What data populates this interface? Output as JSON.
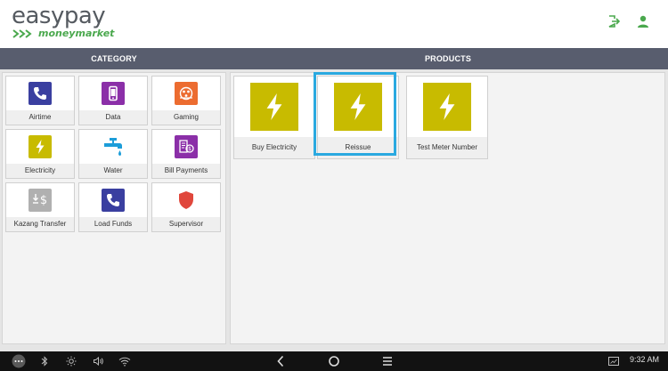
{
  "header": {
    "logo_main": "easypay",
    "logo_sub": "moneymarket",
    "brand_green": "#4aa84d",
    "logout_icon": "logout-icon",
    "user_icon": "user-icon"
  },
  "category": {
    "title": "CATEGORY",
    "items": [
      {
        "label": "Airtime",
        "icon": "phone-icon",
        "color": "#3a3fa0"
      },
      {
        "label": "Data",
        "icon": "mobile-icon",
        "color": "#8b2fa8"
      },
      {
        "label": "Gaming",
        "icon": "lottery-icon",
        "color": "#ec6c30"
      },
      {
        "label": "Electricity",
        "icon": "lightning-icon",
        "color": "#c8bb00"
      },
      {
        "label": "Water",
        "icon": "tap-icon",
        "color": "#1c9dd9"
      },
      {
        "label": "Bill Payments",
        "icon": "bill-icon",
        "color": "#8b2fa8"
      },
      {
        "label": "Kazang Transfer",
        "icon": "transfer-icon",
        "color": "#b0b0b0"
      },
      {
        "label": "Load Funds",
        "icon": "phone-icon",
        "color": "#3a3fa0"
      },
      {
        "label": "Supervisor",
        "icon": "shield-icon",
        "color": "#e0473c"
      }
    ]
  },
  "products": {
    "title": "PRODUCTS",
    "items": [
      {
        "label": "Buy Electricity",
        "icon": "lightning-icon"
      },
      {
        "label": "Reissue",
        "icon": "lightning-icon",
        "selected": true
      },
      {
        "label": "Test Meter Number",
        "icon": "lightning-icon"
      }
    ],
    "tile_color": "#c8bb00",
    "selected_color": "#2aa9e0"
  },
  "system_bar": {
    "time": "9:32 AM"
  }
}
